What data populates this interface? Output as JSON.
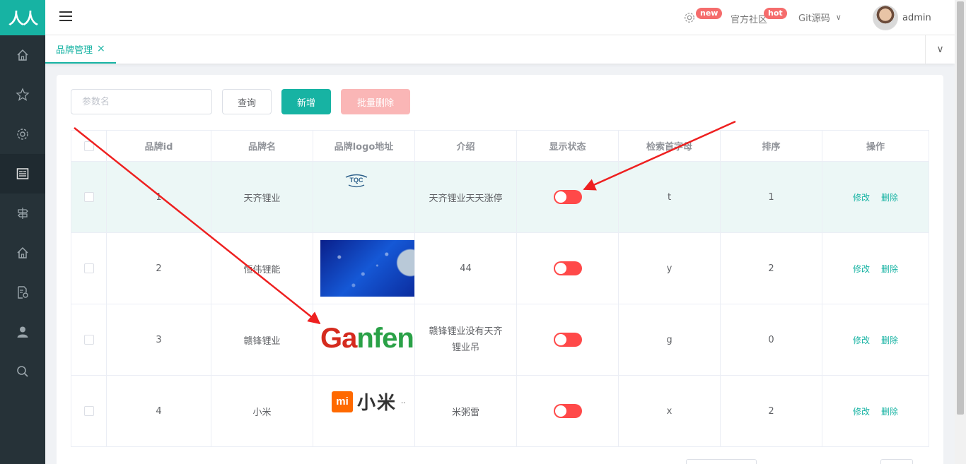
{
  "app": {
    "logo_text": "人人",
    "accent": "#17b3a3"
  },
  "sidebar": {
    "icons": [
      "home-icon",
      "star-icon",
      "gear-icon",
      "news-icon",
      "signpost-icon",
      "home-icon",
      "doc-settings-icon",
      "user-icon",
      "search-icon"
    ]
  },
  "header": {
    "new_badge": "new",
    "community_label": "官方社区",
    "hot_badge": "hot",
    "git_label": "Git源码",
    "username": "admin"
  },
  "tabs": [
    {
      "label": "品牌管理",
      "close": "×"
    }
  ],
  "toolbar": {
    "search_placeholder": "参数名",
    "query_label": "查询",
    "add_label": "新增",
    "batch_delete_label": "批量删除"
  },
  "table": {
    "headers": [
      "品牌id",
      "品牌名",
      "品牌logo地址",
      "介绍",
      "显示状态",
      "检索首字母",
      "排序",
      "操作"
    ],
    "rows": [
      {
        "id": "1",
        "name": "天齐锂业",
        "logo_text": "TQC",
        "desc": "天齐锂业天天涨停",
        "first_letter": "t",
        "sort": "1",
        "shown": false
      },
      {
        "id": "2",
        "name": "恒伟锂能",
        "logo_text": "",
        "desc": "44",
        "first_letter": "y",
        "sort": "2",
        "shown": false
      },
      {
        "id": "3",
        "name": "赣锋锂业",
        "logo_text": "Ganfeng",
        "desc": "赣锋锂业没有天齐锂业吊",
        "first_letter": "g",
        "sort": "0",
        "shown": false
      },
      {
        "id": "4",
        "name": "小米",
        "logo_text": "小米",
        "desc": "米粥雷",
        "first_letter": "x",
        "sort": "2",
        "shown": false
      }
    ],
    "edit_label": "修改",
    "delete_label": "删除"
  },
  "logos": {
    "mi_box": "mi",
    "ganfeng_red": "Ga",
    "ganfeng_green": "nfeng",
    "mi_suffix": ".."
  }
}
